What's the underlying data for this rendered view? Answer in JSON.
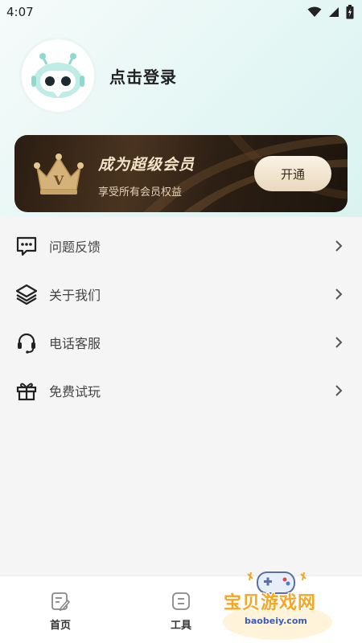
{
  "status_bar": {
    "time": "4:07"
  },
  "profile": {
    "login_text": "点击登录"
  },
  "vip": {
    "title": "成为超级会员",
    "subtitle": "享受所有会员权益",
    "button": "开通",
    "crown_letter": "V"
  },
  "menu": {
    "items": [
      {
        "label": "问题反馈",
        "icon": "feedback-icon"
      },
      {
        "label": "关于我们",
        "icon": "layers-icon"
      },
      {
        "label": "电话客服",
        "icon": "headset-icon"
      },
      {
        "label": "免费试玩",
        "icon": "gift-icon"
      }
    ]
  },
  "tabbar": {
    "tabs": [
      {
        "label": "首页",
        "icon": "edit-doc-icon"
      },
      {
        "label": "工具",
        "icon": "tool-icon"
      }
    ]
  },
  "watermark": {
    "text": "宝贝游戏网",
    "url": "baobeiy.com"
  },
  "colors": {
    "accent_gold": "#f3e3c8",
    "card_dark": "#2a1d12",
    "page_bg": "#f5f5f5",
    "mint": "#bfece4"
  }
}
